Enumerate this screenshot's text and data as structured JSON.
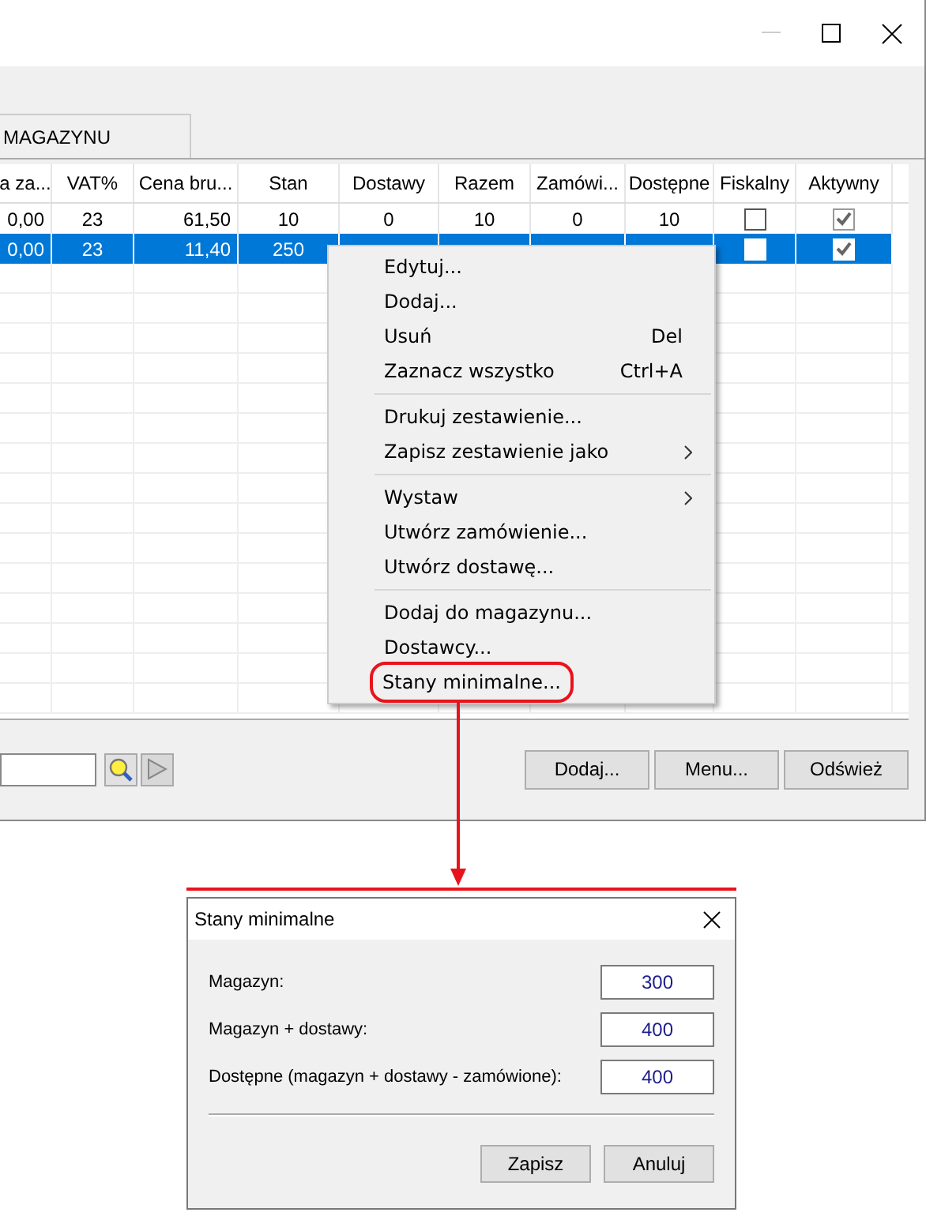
{
  "tab": {
    "label": "MAGAZYNU",
    "selected": true
  },
  "table": {
    "columns": [
      "a za...",
      "VAT%",
      "Cena bru...",
      "Stan",
      "Dostawy",
      "Razem",
      "Zamówi...",
      "Dostępne",
      "Fiskalny",
      "Aktywny"
    ],
    "rows": [
      {
        "selected": false,
        "cells": [
          "0,00",
          "23",
          "61,50",
          "10",
          "0",
          "10",
          "0",
          "10"
        ],
        "fiskalny": false,
        "aktywny": true
      },
      {
        "selected": true,
        "cells": [
          "0,00",
          "23",
          "11,40",
          "250"
        ],
        "fiskalny": false,
        "aktywny": true
      }
    ]
  },
  "bottom_bar": {
    "buttons": [
      "Dodaj...",
      "Menu...",
      "Odśwież"
    ]
  },
  "context_menu": {
    "groups": [
      [
        {
          "label": "Edytuj...",
          "submenu": false,
          "highlighted": false
        },
        {
          "label": "Dodaj...",
          "submenu": false,
          "highlighted": false
        },
        {
          "label": "Usuń",
          "shortcut": "Del",
          "submenu": false,
          "highlighted": false
        },
        {
          "label": "Zaznacz wszystko",
          "shortcut": "Ctrl+A",
          "submenu": false,
          "highlighted": false
        }
      ],
      [
        {
          "label": "Drukuj zestawienie...",
          "submenu": false,
          "highlighted": false
        },
        {
          "label": "Zapisz zestawienie jako",
          "submenu": true,
          "highlighted": false
        }
      ],
      [
        {
          "label": "Wystaw",
          "submenu": true,
          "highlighted": false
        },
        {
          "label": "Utwórz zamówienie...",
          "submenu": false,
          "highlighted": false
        },
        {
          "label": "Utwórz dostawę...",
          "submenu": false,
          "highlighted": false
        }
      ],
      [
        {
          "label": "Dodaj do magazynu...",
          "submenu": false,
          "highlighted": false
        },
        {
          "label": "Dostawcy...",
          "submenu": false,
          "highlighted": false
        },
        {
          "label": "Stany minimalne...",
          "submenu": false,
          "highlighted": true
        }
      ]
    ]
  },
  "dialog": {
    "title": "Stany minimalne",
    "fields": [
      {
        "label": "Magazyn:",
        "value": "300"
      },
      {
        "label": "Magazyn + dostawy:",
        "value": "400"
      },
      {
        "label": "Dostępne (magazyn + dostawy - zamówione):",
        "value": "400"
      }
    ],
    "buttons": [
      "Zapisz",
      "Anuluj"
    ]
  }
}
